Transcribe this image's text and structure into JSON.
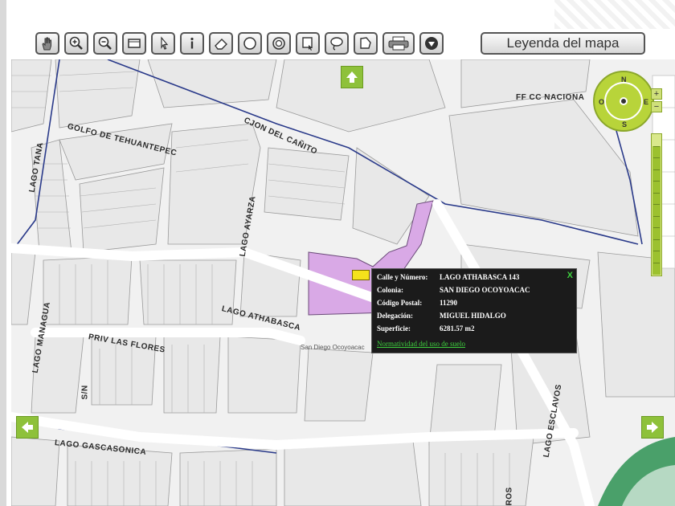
{
  "toolbar": {
    "tools": [
      "pan-hand-icon",
      "zoom-in-icon",
      "zoom-out-icon",
      "full-extent-icon",
      "identify-pointer-icon",
      "info-icon",
      "eraser-icon",
      "circle-select-icon",
      "buffer-icon",
      "rectangle-select-icon",
      "lasso-select-icon",
      "polygon-select-icon",
      "print-icon",
      "download-icon"
    ],
    "legend_button": "Leyenda del mapa"
  },
  "map": {
    "streets": {
      "cjon_del_canito": "CJON DEL CAÑITO",
      "golfo_de_tehuantepec": "GOLFO DE TEHUANTEPEC",
      "lago_tana": "LAGO TANA",
      "lago_ayarza": "LAGO AYARZA",
      "lago_athabasca": "LAGO ATHABASCA",
      "priv_las_flores": "PRIV LAS FLORES",
      "lago_managua": "LAGO MANAGUA",
      "sn": "S/N",
      "lago_gascasonica": "LAGO GASCASONICA",
      "lago_esclavos": "LAGO ESCLAVOS",
      "ff_cc_nacional": "FF CC NACIONA",
      "ros": "ROS"
    },
    "place_label": "San Diego Ocoyoacac",
    "highlight_color": "#d9a9e6",
    "park_color": "#4aa06a",
    "nav_color": "#8ec13a"
  },
  "compass": {
    "n": "N",
    "s": "S",
    "e": "E",
    "o": "O"
  },
  "zoom": {
    "plus": "+",
    "minus": "−",
    "level": 0.92
  },
  "popup": {
    "rows": [
      {
        "label": "Calle y Número:",
        "value": "LAGO ATHABASCA 143"
      },
      {
        "label": "Colonia:",
        "value": "SAN DIEGO OCOYOACAC"
      },
      {
        "label": "Código Postal:",
        "value": "11290"
      },
      {
        "label": "Delegación:",
        "value": "MIGUEL HIDALGO"
      },
      {
        "label": "Superficie:",
        "value": "6281.57 m2"
      }
    ],
    "link": "Normatividad del uso de suelo",
    "close": "X"
  }
}
